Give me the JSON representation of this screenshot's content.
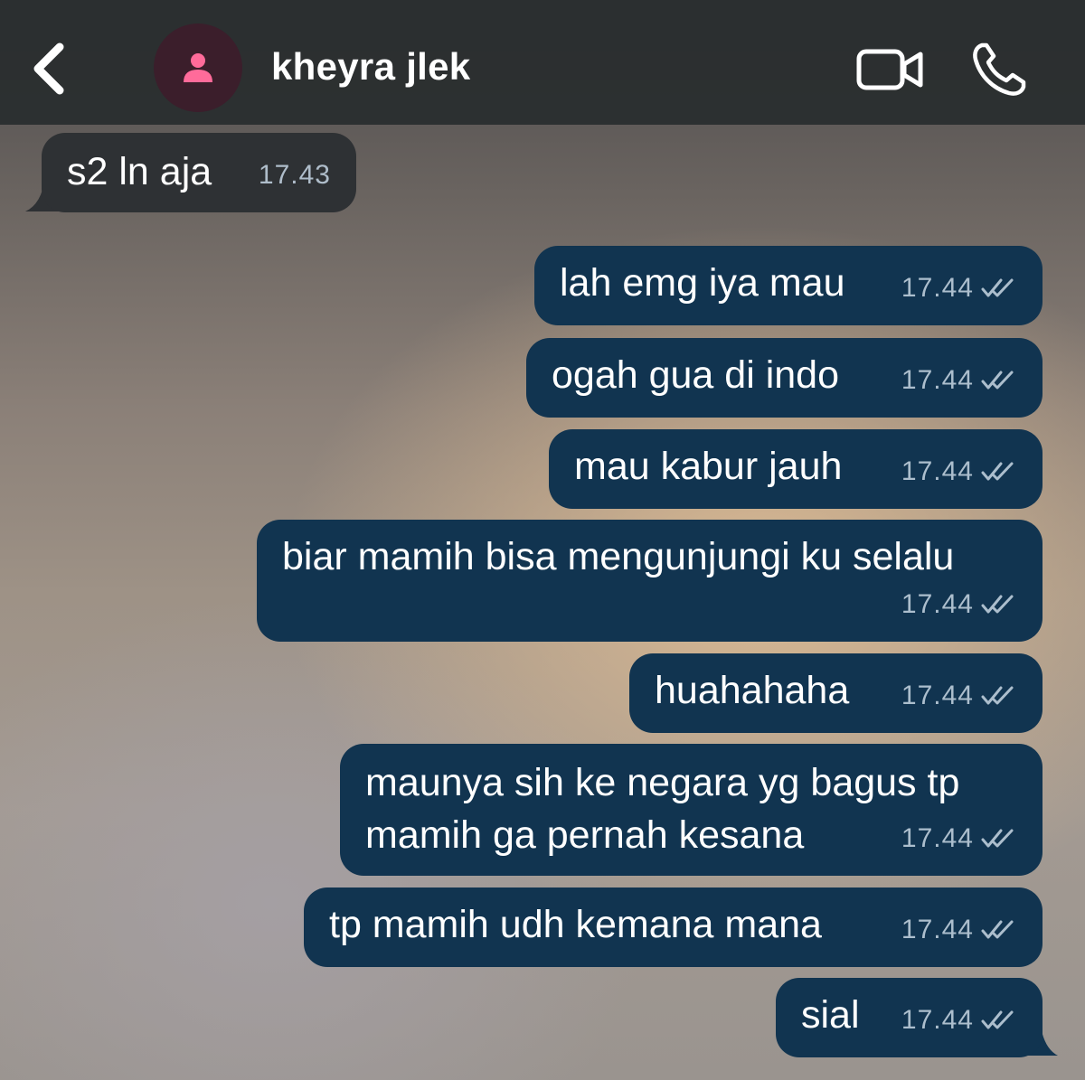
{
  "header": {
    "contact_name": "kheyra jlek",
    "icons": [
      "back-chevron-icon",
      "person-icon",
      "video-camera-icon",
      "phone-icon"
    ],
    "avatar_bg": "#3b1e2b",
    "avatar_accent": "#ff6b9a"
  },
  "messages": [
    {
      "dir": "in",
      "text": "s2 ln aja",
      "time": "17.43"
    },
    {
      "dir": "out",
      "text": "lah emg iya mau",
      "time": "17.44",
      "status": "read"
    },
    {
      "dir": "out",
      "text": "ogah gua di indo",
      "time": "17.44",
      "status": "read"
    },
    {
      "dir": "out",
      "text": "mau kabur jauh",
      "time": "17.44",
      "status": "read"
    },
    {
      "dir": "out",
      "text": "biar mamih bisa mengunjungi ku selalu",
      "time": "17.44",
      "status": "read"
    },
    {
      "dir": "out",
      "text": "huahahaha",
      "time": "17.44",
      "status": "read"
    },
    {
      "dir": "out",
      "text_line1": "maunya sih ke negara yg bagus tp",
      "text_line2": "mamih ga pernah kesana",
      "time": "17.44",
      "status": "read"
    },
    {
      "dir": "out",
      "text": "tp mamih udh kemana mana",
      "time": "17.44",
      "status": "read"
    },
    {
      "dir": "out",
      "text": "sial",
      "time": "17.44",
      "status": "read"
    }
  ],
  "colors": {
    "outgoing_bubble": "#113450",
    "incoming_bubble": "#2e3134"
  }
}
